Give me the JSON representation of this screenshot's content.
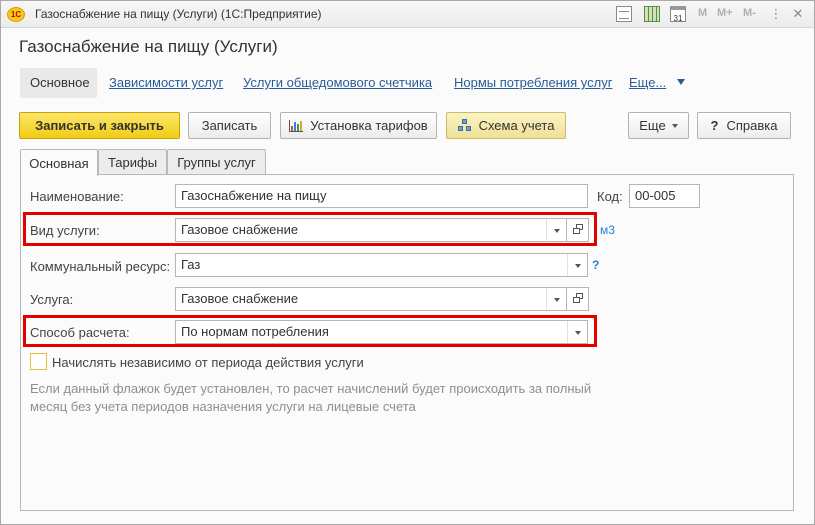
{
  "window": {
    "title": "Газоснабжение на пищу (Услуги)  (1С:Предприятие)",
    "logo": "1С",
    "calendar_num": "31",
    "m_buttons": [
      "M",
      "M+",
      "M-"
    ]
  },
  "form": {
    "title": "Газоснабжение на пищу (Услуги)"
  },
  "nav": {
    "active": "Основное",
    "links": [
      "Зависимости услуг",
      "Услуги общедомового счетчика",
      "Нормы потребления услуг",
      "Еще..."
    ]
  },
  "toolbar": {
    "save_close": "Записать и закрыть",
    "save": "Записать",
    "tariffs": "Установка тарифов",
    "scheme": "Схема учета",
    "more": "Еще",
    "help": "Справка",
    "help_icon": "?"
  },
  "tabs": [
    "Основная",
    "Тарифы",
    "Группы услуг"
  ],
  "fields": {
    "name_label": "Наименование:",
    "name_value": "Газоснабжение на пищу",
    "code_label": "Код:",
    "code_value": "00-005",
    "service_type_label": "Вид услуги:",
    "service_type_value": "Газовое снабжение",
    "unit_link": "м3",
    "resource_label": "Коммунальный ресурс:",
    "resource_value": "Газ",
    "resource_help": "?",
    "service_label": "Услуга:",
    "service_value": "Газовое снабжение",
    "calc_label": "Способ расчета:",
    "calc_value": "По нормам потребления",
    "checkbox_label": "Начислять независимо от периода действия услуги",
    "checkbox_checked": false,
    "hint": "Если данный флажок будет установлен, то расчет начислений будет происходить за полный месяц без учета периодов назначения услуги на лицевые счета"
  },
  "colors": {
    "highlight": "#e00000",
    "primary_button": "#f2cd14",
    "link": "#2a5d96"
  }
}
